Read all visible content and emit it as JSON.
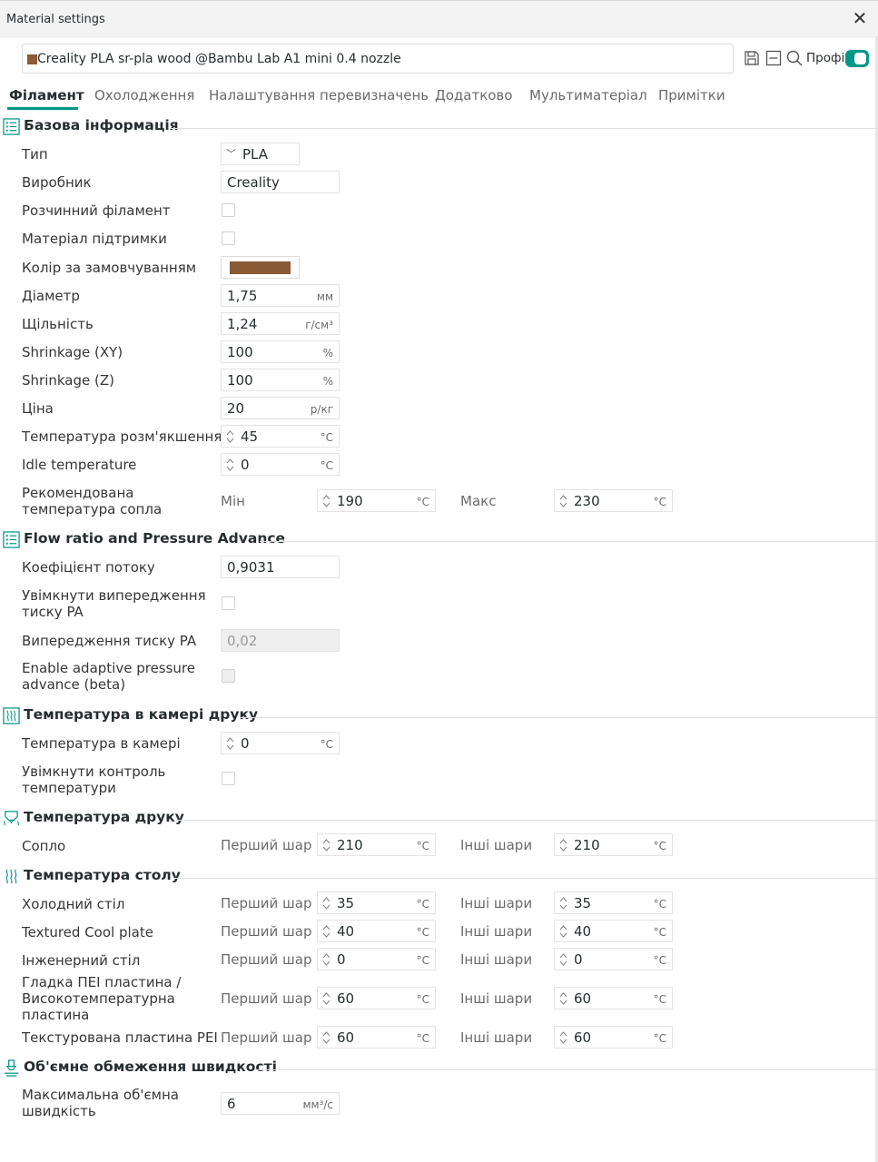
{
  "window": {
    "title": "Material settings",
    "close_glyph": "✕"
  },
  "preset": {
    "name": "Creality PLA sr-pla wood @Bambu Lab A1 mini 0.4 nozzle",
    "swatch_color": "#8a5a35"
  },
  "toolbar": {
    "icons": [
      "save-icon",
      "delete-icon",
      "search-icon"
    ],
    "advanced_label": "Профі",
    "advanced_on": true,
    "accent_color": "#009688"
  },
  "tabs": [
    {
      "label": "Філамент",
      "active": true
    },
    {
      "label": "Охолодження",
      "active": false
    },
    {
      "label": "Налаштування перевизначень",
      "active": false
    },
    {
      "label": "Додатково",
      "active": false
    },
    {
      "label": "Мультиматеріал",
      "active": false
    },
    {
      "label": "Примітки",
      "active": false
    }
  ],
  "basic": {
    "title": "Базова інформація",
    "type": {
      "label": "Тип",
      "value": "PLA"
    },
    "vendor": {
      "label": "Виробник",
      "value": "Creality"
    },
    "soluble": {
      "label": "Розчинний філамент",
      "checked": false
    },
    "support": {
      "label": "Матеріал підтримки",
      "checked": false
    },
    "color": {
      "label": "Колір за замовчуванням",
      "value": "#8a5a35"
    },
    "diameter": {
      "label": "Діаметр",
      "value": "1,75",
      "unit": "мм"
    },
    "density": {
      "label": "Щільність",
      "value": "1,24",
      "unit": "г/см³"
    },
    "shrink_xy": {
      "label": "Shrinkage (XY)",
      "value": "100",
      "unit": "%"
    },
    "shrink_z": {
      "label": "Shrinkage (Z)",
      "value": "100",
      "unit": "%"
    },
    "cost": {
      "label": "Ціна",
      "value": "20",
      "unit": "р/кг"
    },
    "softening": {
      "label": "Температура розм'якшення",
      "value": "45",
      "unit": "°C"
    },
    "idle": {
      "label": "Idle temperature",
      "value": "0",
      "unit": "°C"
    },
    "nozzle_range": {
      "label_line1": "Рекомендована",
      "label_line2": "температура сопла",
      "min_label": "Мін",
      "min_value": "190",
      "max_label": "Макс",
      "max_value": "230",
      "unit": "°C"
    }
  },
  "flow": {
    "title": "Flow ratio and Pressure Advance",
    "ratio": {
      "label": "Коефіцієнт потоку",
      "value": "0,9031"
    },
    "enable_pa": {
      "label_line1": "Увімкнути випередження",
      "label_line2": "тиску PA",
      "checked": false
    },
    "pa": {
      "label": "Випередження тиску PA",
      "value": "0,02"
    },
    "adaptive_pa": {
      "label_line1": "Enable adaptive pressure",
      "label_line2": "advance (beta)",
      "checked": false
    }
  },
  "chamber": {
    "title": "Температура в камері друку",
    "temp": {
      "label": "Температура в камері",
      "value": "0",
      "unit": "°C"
    },
    "control": {
      "label_line1": "Увімкнути контроль",
      "label_line2": "температури",
      "checked": false
    }
  },
  "print_temp": {
    "title": "Температура друку",
    "nozzle": {
      "label": "Сопло",
      "first_label": "Перший шар",
      "first_value": "210",
      "other_label": "Інші шари",
      "other_value": "210",
      "unit": "°C"
    }
  },
  "bed_temp": {
    "title": "Температура столу",
    "first_label": "Перший шар",
    "other_label": "Інші шари",
    "unit": "°C",
    "rows": [
      {
        "label": "Холодний стіл",
        "first": "35",
        "other": "35"
      },
      {
        "label": "Textured Cool plate",
        "first": "40",
        "other": "40"
      },
      {
        "label": "Інженерний стіл",
        "first": "0",
        "other": "0"
      },
      {
        "label_line1": "Гладка ПЕІ пластина /",
        "label_line2": "Високотемпературна",
        "label_line3": "пластина",
        "first": "60",
        "other": "60"
      },
      {
        "label": "Текстурована пластина PEI",
        "first": "60",
        "other": "60"
      }
    ]
  },
  "volumetric": {
    "title": "Об'ємне обмеження швидкості",
    "max": {
      "label_line1": "Максимальна об'ємна",
      "label_line2": "швидкість",
      "value": "6",
      "unit": "мм³/с"
    }
  }
}
